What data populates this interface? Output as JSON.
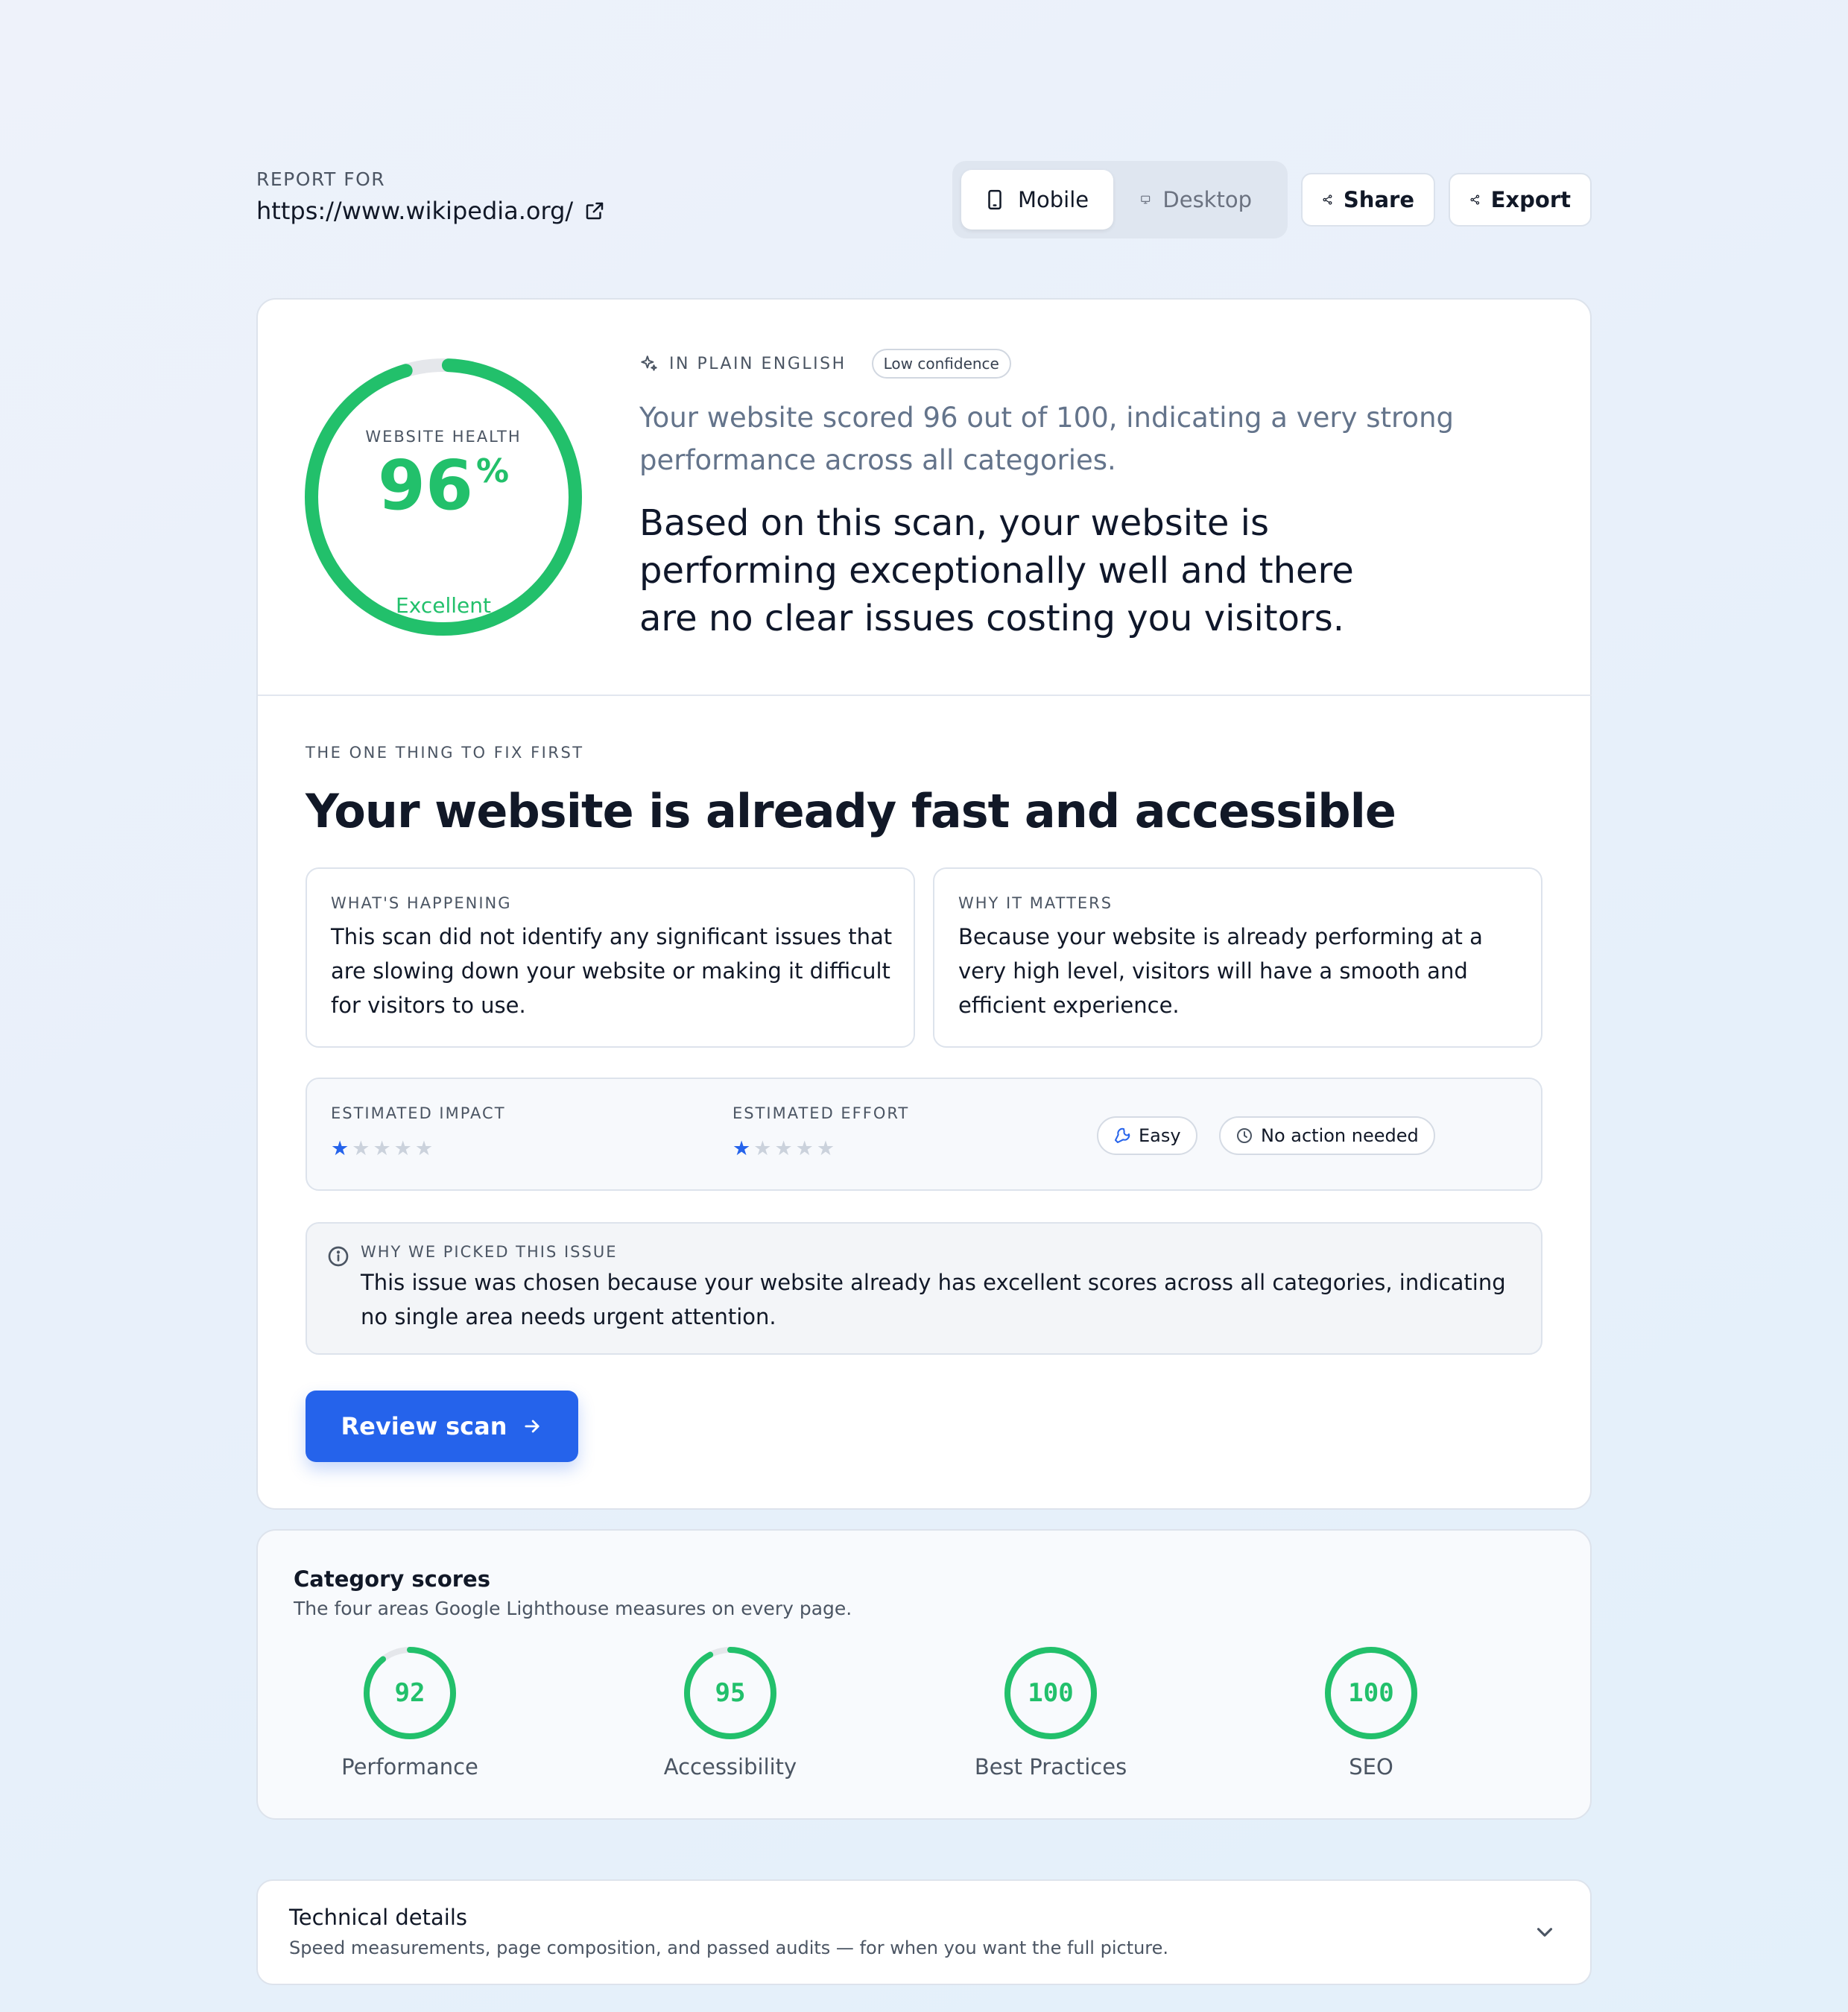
{
  "header": {
    "report_for_label": "REPORT FOR",
    "url": "https://www.wikipedia.org/",
    "device_toggle": {
      "mobile": "Mobile",
      "desktop": "Desktop",
      "selected": "Mobile"
    },
    "share_label": "Share",
    "export_label": "Export"
  },
  "health": {
    "label": "WEBSITE HEALTH",
    "value": "96",
    "unit": "%",
    "score_fraction": 0.96,
    "rating": "Excellent",
    "color": "#22c06b"
  },
  "plain_english": {
    "label": "IN PLAIN ENGLISH",
    "confidence_badge": "Low confidence",
    "subtitle": "Your website scored 96 out of 100, indicating a very strong performance across all categories.",
    "headline": "Based on this scan, your website is performing exceptionally well and there are no clear issues costing you visitors."
  },
  "fix_first": {
    "label": "THE ONE THING TO FIX FIRST",
    "title": "Your website is already fast and accessible",
    "whats_happening": {
      "label": "WHAT'S HAPPENING",
      "text": "This scan did not identify any significant issues that are slowing down your website or making it difficult for visitors to use."
    },
    "why_it_matters": {
      "label": "WHY IT MATTERS",
      "text": "Because your website is already performing at a very high level, visitors will have a smooth and efficient experience."
    },
    "estimated_impact": {
      "label": "ESTIMATED IMPACT",
      "stars": 1,
      "max": 5
    },
    "estimated_effort": {
      "label": "ESTIMATED EFFORT",
      "stars": 1,
      "max": 5
    },
    "effort_pill": "Easy",
    "action_pill": "No action needed",
    "why_picked": {
      "label": "WHY WE PICKED THIS ISSUE",
      "text": "This issue was chosen because your website already has excellent scores across all categories, indicating no single area needs urgent attention."
    },
    "cta_label": "Review scan"
  },
  "categories": {
    "title": "Category scores",
    "subtitle": "The four areas Google Lighthouse measures on every page.",
    "items": [
      {
        "name": "Performance",
        "score": "92"
      },
      {
        "name": "Accessibility",
        "score": "95"
      },
      {
        "name": "Best Practices",
        "score": "100"
      },
      {
        "name": "SEO",
        "score": "100"
      }
    ],
    "color": "#22c06b"
  },
  "technical": {
    "title": "Technical details",
    "subtitle": "Speed measurements, page composition, and passed audits — for when you want the full picture."
  },
  "icons": {
    "external": "external-link-icon",
    "mobile": "smartphone-icon",
    "desktop": "monitor-icon",
    "share": "share-icon",
    "export": "share-icon",
    "sparkle": "sparkle-icon",
    "wrench": "wrench-icon",
    "clock": "clock-icon",
    "info": "info-icon",
    "arrow": "arrow-right-icon",
    "chevron": "chevron-down-icon"
  }
}
